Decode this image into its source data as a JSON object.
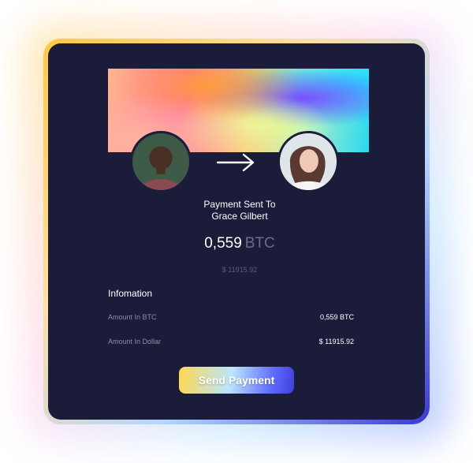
{
  "payment": {
    "title_line1": "Payment Sent To",
    "title_line2": "Grace Gilbert",
    "amount": "0,559",
    "unit": "BTC",
    "fiat": "$ 11915.92"
  },
  "info": {
    "heading": "Infomation",
    "rows": [
      {
        "label": "Amount In BTC",
        "value": "0,559 BTC"
      },
      {
        "label": "Amount In Dollar",
        "value": "$ 11915.92"
      }
    ]
  },
  "actions": {
    "send_label": "Send Payment"
  },
  "icons": {
    "arrow": "arrow-right-icon"
  },
  "colors": {
    "card_background": "#1b1c3a",
    "text_primary": "#ffffff",
    "text_muted": "#8c8ea6",
    "button_gradient_start": "#ffd84a",
    "button_gradient_end": "#3f3ddc"
  }
}
